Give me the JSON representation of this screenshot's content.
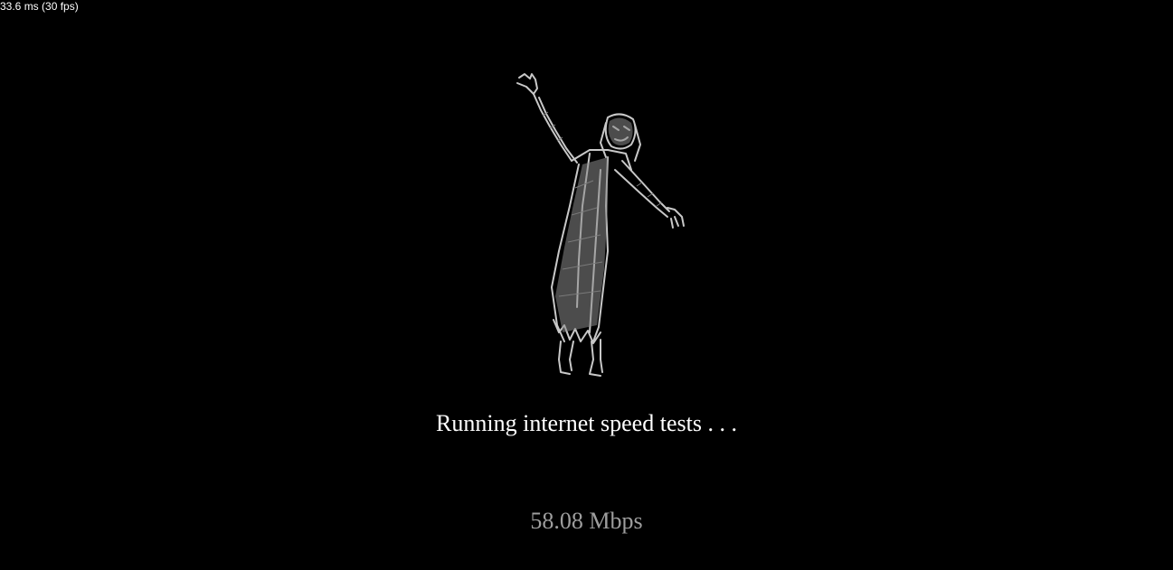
{
  "overlay": {
    "frame_time": "33.6 ms (30 fps)"
  },
  "loading": {
    "illustration_icon": "zombie-figure-icon",
    "status_message": "Running internet speed tests . . .",
    "speed_reading": "58.08 Mbps"
  },
  "colors": {
    "background": "#000000",
    "status_text": "#ffffff",
    "speed_text": "#9e9e9e",
    "figure": "#bdbdbd"
  }
}
